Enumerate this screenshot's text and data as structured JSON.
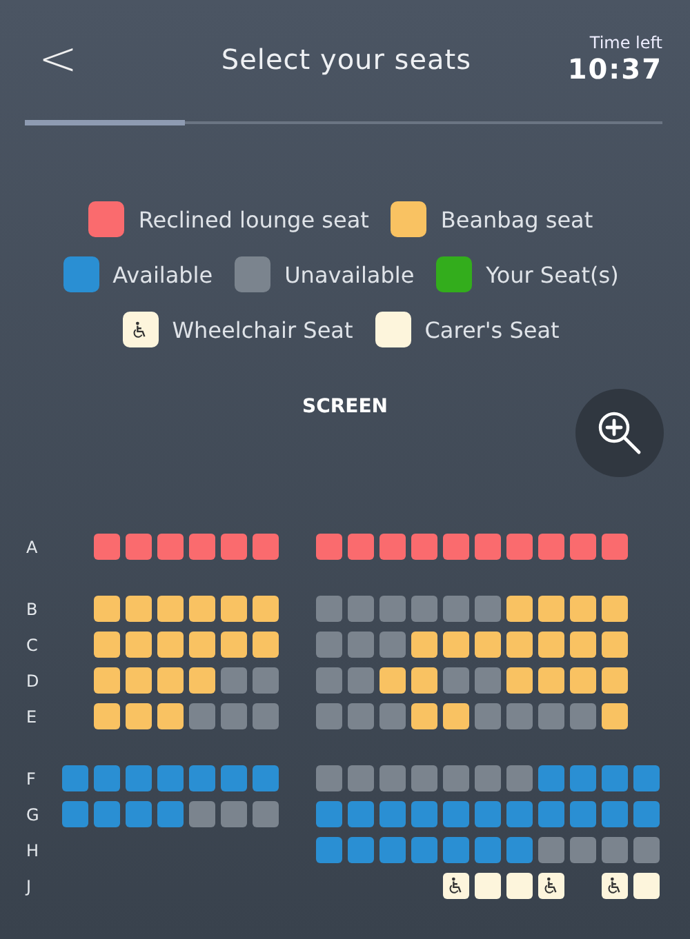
{
  "header": {
    "back": "<",
    "title": "Select your seats",
    "timer_label": "Time left",
    "timer": "10:37"
  },
  "progress": {
    "level": 0.25
  },
  "legend": [
    [
      {
        "kind": "recliner",
        "label": "Reclined lounge seat"
      },
      {
        "kind": "beanbag",
        "label": "Beanbag seat"
      }
    ],
    [
      {
        "kind": "available",
        "label": "Available"
      },
      {
        "kind": "unavailable",
        "label": "Unavailable"
      },
      {
        "kind": "mine",
        "label": "Your Seat(s)"
      }
    ],
    [
      {
        "kind": "wheelchair",
        "label": "Wheelchair Seat"
      },
      {
        "kind": "carer",
        "label": "Carer's Seat"
      }
    ]
  ],
  "screen_label": "SCREEN",
  "sections": [
    {
      "rows": [
        {
          "label": "A",
          "left": [
            {
              "kind": "gap"
            },
            {
              "kind": "recliner"
            },
            {
              "kind": "recliner"
            },
            {
              "kind": "recliner"
            },
            {
              "kind": "recliner"
            },
            {
              "kind": "recliner"
            },
            {
              "kind": "recliner"
            }
          ],
          "right": [
            {
              "kind": "recliner"
            },
            {
              "kind": "recliner"
            },
            {
              "kind": "recliner"
            },
            {
              "kind": "recliner"
            },
            {
              "kind": "recliner"
            },
            {
              "kind": "recliner"
            },
            {
              "kind": "recliner"
            },
            {
              "kind": "recliner"
            },
            {
              "kind": "recliner"
            },
            {
              "kind": "recliner"
            }
          ]
        }
      ]
    },
    {
      "rows": [
        {
          "label": "B",
          "left": [
            {
              "kind": "gap"
            },
            {
              "kind": "beanbag"
            },
            {
              "kind": "beanbag"
            },
            {
              "kind": "beanbag"
            },
            {
              "kind": "beanbag"
            },
            {
              "kind": "beanbag"
            },
            {
              "kind": "beanbag"
            }
          ],
          "right": [
            {
              "kind": "unavailable"
            },
            {
              "kind": "unavailable"
            },
            {
              "kind": "unavailable"
            },
            {
              "kind": "unavailable"
            },
            {
              "kind": "unavailable"
            },
            {
              "kind": "unavailable"
            },
            {
              "kind": "beanbag"
            },
            {
              "kind": "beanbag"
            },
            {
              "kind": "beanbag"
            },
            {
              "kind": "beanbag"
            }
          ]
        },
        {
          "label": "C",
          "left": [
            {
              "kind": "gap"
            },
            {
              "kind": "beanbag"
            },
            {
              "kind": "beanbag"
            },
            {
              "kind": "beanbag"
            },
            {
              "kind": "beanbag"
            },
            {
              "kind": "beanbag"
            },
            {
              "kind": "beanbag"
            }
          ],
          "right": [
            {
              "kind": "unavailable"
            },
            {
              "kind": "unavailable"
            },
            {
              "kind": "unavailable"
            },
            {
              "kind": "beanbag"
            },
            {
              "kind": "beanbag"
            },
            {
              "kind": "beanbag"
            },
            {
              "kind": "beanbag"
            },
            {
              "kind": "beanbag"
            },
            {
              "kind": "beanbag"
            },
            {
              "kind": "beanbag"
            }
          ]
        },
        {
          "label": "D",
          "left": [
            {
              "kind": "gap"
            },
            {
              "kind": "beanbag"
            },
            {
              "kind": "beanbag"
            },
            {
              "kind": "beanbag"
            },
            {
              "kind": "beanbag"
            },
            {
              "kind": "unavailable"
            },
            {
              "kind": "unavailable"
            }
          ],
          "right": [
            {
              "kind": "unavailable"
            },
            {
              "kind": "unavailable"
            },
            {
              "kind": "beanbag"
            },
            {
              "kind": "beanbag"
            },
            {
              "kind": "unavailable"
            },
            {
              "kind": "unavailable"
            },
            {
              "kind": "beanbag"
            },
            {
              "kind": "beanbag"
            },
            {
              "kind": "beanbag"
            },
            {
              "kind": "beanbag"
            }
          ]
        },
        {
          "label": "E",
          "left": [
            {
              "kind": "gap"
            },
            {
              "kind": "beanbag"
            },
            {
              "kind": "beanbag"
            },
            {
              "kind": "beanbag"
            },
            {
              "kind": "unavailable"
            },
            {
              "kind": "unavailable"
            },
            {
              "kind": "unavailable"
            }
          ],
          "right": [
            {
              "kind": "unavailable"
            },
            {
              "kind": "unavailable"
            },
            {
              "kind": "unavailable"
            },
            {
              "kind": "beanbag"
            },
            {
              "kind": "beanbag"
            },
            {
              "kind": "unavailable"
            },
            {
              "kind": "unavailable"
            },
            {
              "kind": "unavailable"
            },
            {
              "kind": "unavailable"
            },
            {
              "kind": "beanbag"
            }
          ]
        }
      ]
    },
    {
      "rows": [
        {
          "label": "F",
          "left": [
            {
              "kind": "available"
            },
            {
              "kind": "available"
            },
            {
              "kind": "available"
            },
            {
              "kind": "available"
            },
            {
              "kind": "available"
            },
            {
              "kind": "available"
            },
            {
              "kind": "available"
            }
          ],
          "right": [
            {
              "kind": "unavailable"
            },
            {
              "kind": "unavailable"
            },
            {
              "kind": "unavailable"
            },
            {
              "kind": "unavailable"
            },
            {
              "kind": "unavailable"
            },
            {
              "kind": "unavailable"
            },
            {
              "kind": "unavailable"
            },
            {
              "kind": "available"
            },
            {
              "kind": "available"
            },
            {
              "kind": "available"
            },
            {
              "kind": "available"
            }
          ]
        },
        {
          "label": "G",
          "left": [
            {
              "kind": "available"
            },
            {
              "kind": "available"
            },
            {
              "kind": "available"
            },
            {
              "kind": "available"
            },
            {
              "kind": "unavailable"
            },
            {
              "kind": "unavailable"
            },
            {
              "kind": "unavailable"
            }
          ],
          "right": [
            {
              "kind": "available"
            },
            {
              "kind": "available"
            },
            {
              "kind": "available"
            },
            {
              "kind": "available"
            },
            {
              "kind": "available"
            },
            {
              "kind": "available"
            },
            {
              "kind": "available"
            },
            {
              "kind": "available"
            },
            {
              "kind": "available"
            },
            {
              "kind": "available"
            },
            {
              "kind": "available"
            }
          ]
        },
        {
          "label": "H",
          "right": [
            {
              "kind": "available"
            },
            {
              "kind": "available"
            },
            {
              "kind": "available"
            },
            {
              "kind": "available"
            },
            {
              "kind": "available"
            },
            {
              "kind": "available"
            },
            {
              "kind": "available"
            },
            {
              "kind": "unavailable"
            },
            {
              "kind": "unavailable"
            },
            {
              "kind": "unavailable"
            },
            {
              "kind": "unavailable"
            }
          ]
        },
        {
          "label": "J",
          "right": [
            {
              "kind": "gap"
            },
            {
              "kind": "gap"
            },
            {
              "kind": "gap"
            },
            {
              "kind": "gap"
            },
            {
              "kind": "wheelchair"
            },
            {
              "kind": "carer"
            },
            {
              "kind": "carer"
            },
            {
              "kind": "wheelchair"
            },
            {
              "kind": "gap"
            },
            {
              "kind": "wheelchair"
            },
            {
              "kind": "carer"
            }
          ]
        }
      ]
    }
  ]
}
